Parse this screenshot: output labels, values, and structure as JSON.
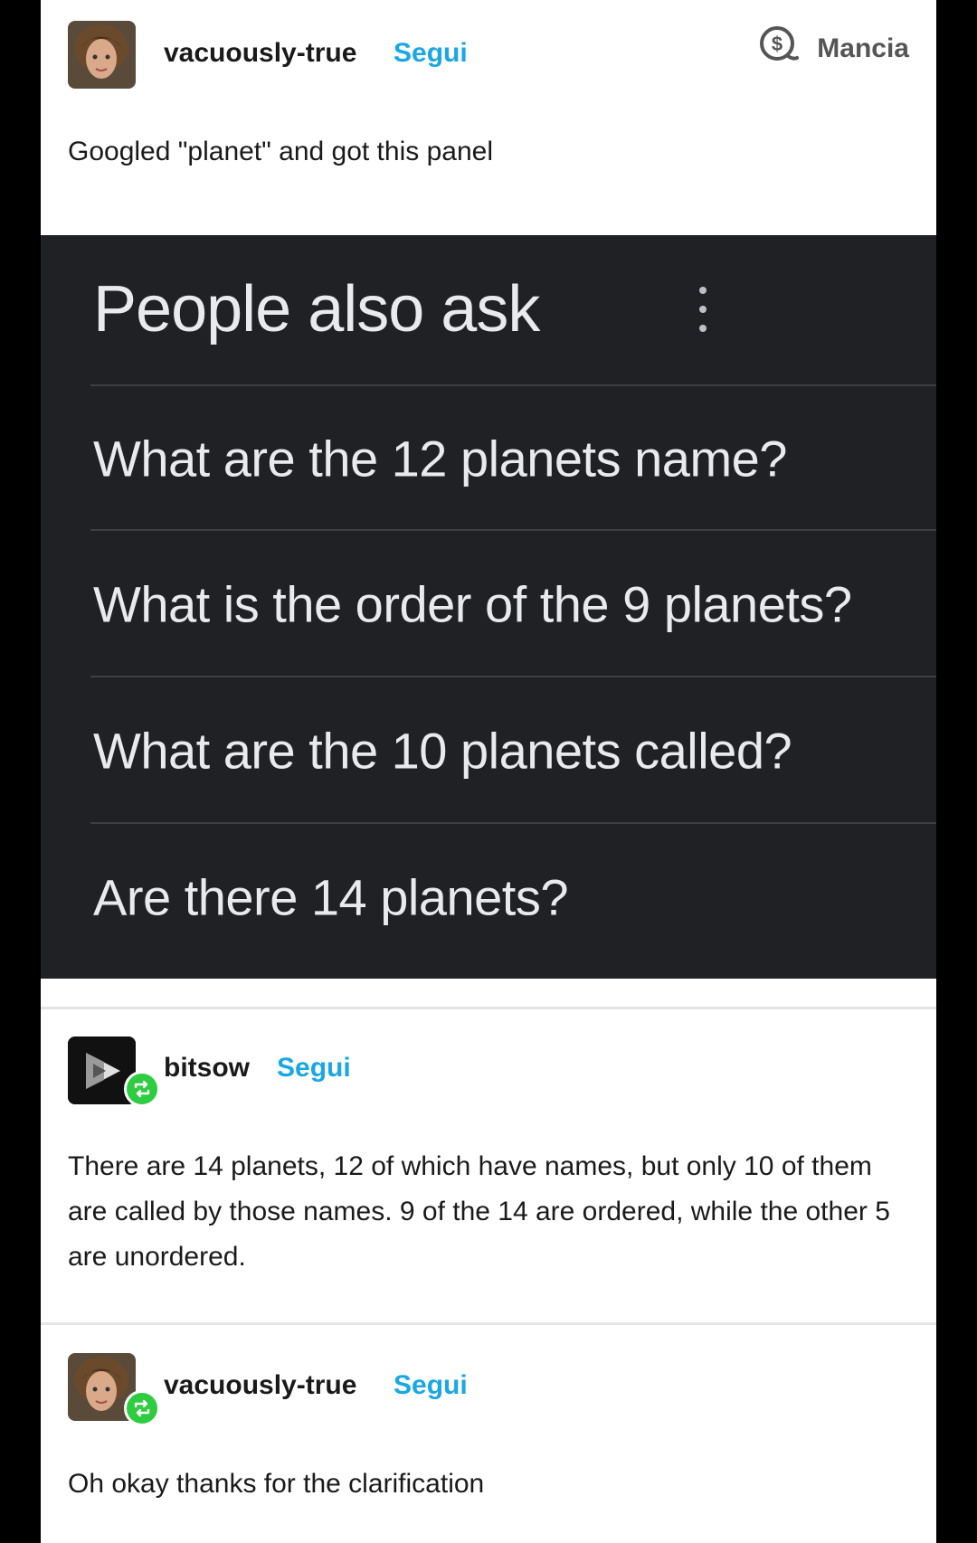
{
  "post1": {
    "username": "vacuously-true",
    "follow": "Segui",
    "tip_label": "Mancia",
    "text": "Googled \"planet\" and got this panel"
  },
  "search_panel": {
    "title": "People also ask",
    "questions": [
      "What are the 12 planets name?",
      "What is the order of the 9 planets?",
      "What are the 10 planets called?",
      "Are there 14 planets?"
    ]
  },
  "reply1": {
    "username": "bitsow",
    "follow": "Segui",
    "text": "There are 14 planets, 12 of which have names, but only 10 of them are called by those names. 9 of the 14 are ordered, while the other 5 are unordered."
  },
  "reply2": {
    "username": "vacuously-true",
    "follow": "Segui",
    "text": "Oh okay thanks for the clarification"
  },
  "colors": {
    "follow_blue": "#1aa7e6",
    "reblog_green": "#2ecc40",
    "panel_bg": "#202124"
  },
  "icons": [
    "tip-dollar-icon",
    "kebab-menu-icon",
    "reblog-icon"
  ]
}
